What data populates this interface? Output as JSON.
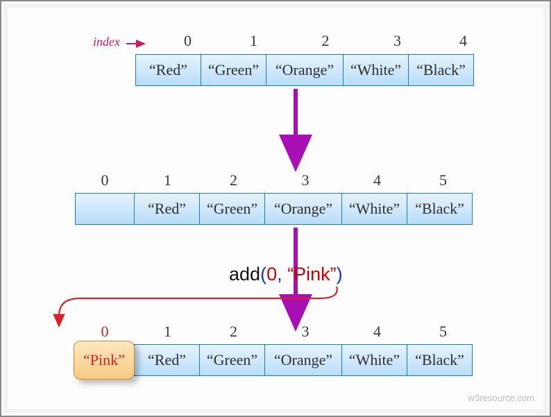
{
  "indexLabel": "index",
  "row1": {
    "idx": [
      "0",
      "1",
      "2",
      "3",
      "4"
    ],
    "cells": [
      "“Red”",
      "“Green”",
      "“Orange”",
      "“White”",
      "“Black”"
    ]
  },
  "row2": {
    "idx": [
      "0",
      "1",
      "2",
      "3",
      "4",
      "5"
    ],
    "cells": [
      "",
      "“Red”",
      "“Green”",
      "“Orange”",
      "“White”",
      "“Black”"
    ]
  },
  "row3": {
    "idx": [
      "0",
      "1",
      "2",
      "3",
      "4",
      "5"
    ],
    "cells": [
      "“Pink”",
      "“Red”",
      "“Green”",
      "“Orange”",
      "“White”",
      "“Black”"
    ]
  },
  "op": {
    "fn": "add",
    "open": "(",
    "arg0": "0",
    "comma": ", ",
    "arg1": "“Pink”",
    "close": ")"
  },
  "watermark": "w3resource.com"
}
